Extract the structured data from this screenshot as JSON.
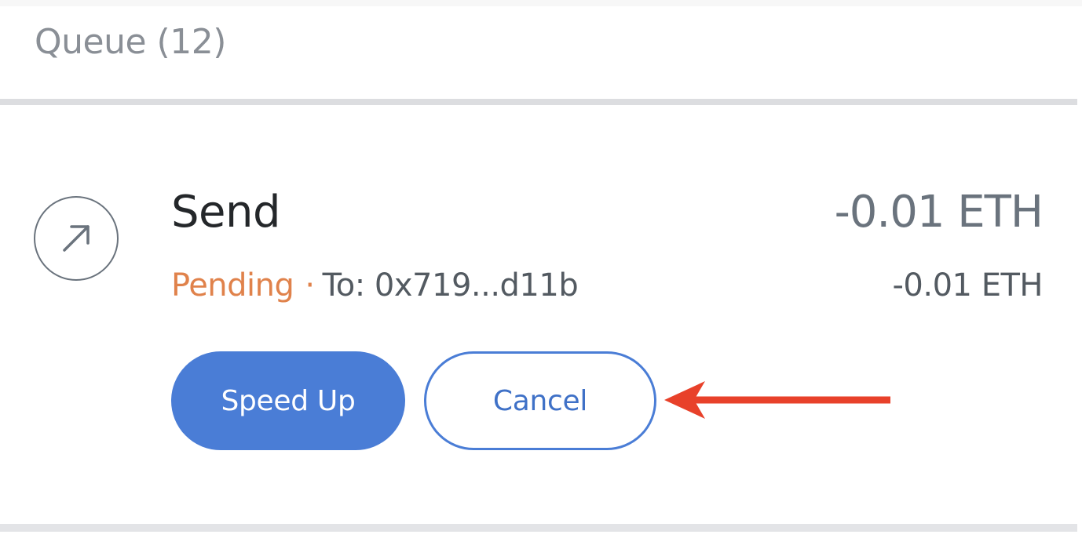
{
  "queue": {
    "title": "Queue (12)"
  },
  "transaction": {
    "icon": "arrow-up-right-icon",
    "title": "Send",
    "status": "Pending",
    "separator": "·",
    "recipient": "To: 0x719...d11b",
    "amount_primary": "-0.01 ETH",
    "amount_secondary": "-0.01 ETH",
    "actions": {
      "speed_up_label": "Speed Up",
      "cancel_label": "Cancel"
    }
  },
  "annotation": {
    "icon": "pointer-arrow-icon",
    "color": "#e8412a"
  },
  "colors": {
    "accent": "#4a7dd6",
    "pending": "#e0824b",
    "muted": "#6a737d"
  }
}
